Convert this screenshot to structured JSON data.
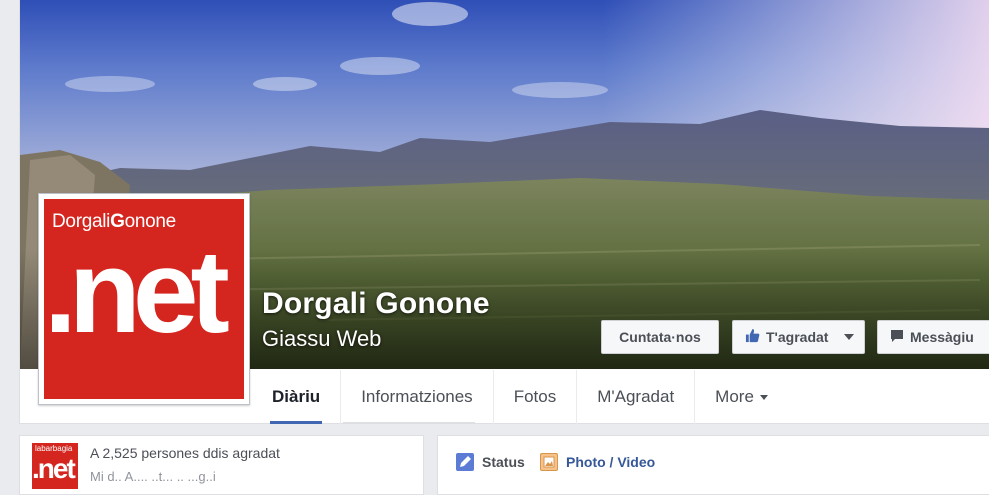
{
  "page": {
    "name": "Dorgali Gonone",
    "category": "Giassu Web"
  },
  "profile_logo": {
    "top_text_a": "Dorgali",
    "top_text_b": "G",
    "top_text_c": "onone",
    "big_text": ".net"
  },
  "actions": {
    "contact_label": "Cuntata·nos",
    "like_label": "T'agradat",
    "message_label": "Messàgiu"
  },
  "tabs": [
    {
      "label": "Diàriu"
    },
    {
      "label": "Informatziones"
    },
    {
      "label": "Fotos"
    },
    {
      "label": "M'Agradat"
    },
    {
      "label": "More"
    }
  ],
  "about_card": {
    "likes_text": "A 2,525 persones ddis agradat",
    "sub_text": "Mi d.. A.... ..t... .. ...g..i",
    "mini_logo_small": "labarbagia",
    "mini_logo_big": ".net"
  },
  "composer": {
    "status_label": "Status",
    "photo_label": "Photo / Video"
  },
  "colors": {
    "brand_red": "#d4251f",
    "fb_blue": "#4267b2",
    "link_blue": "#365899"
  }
}
